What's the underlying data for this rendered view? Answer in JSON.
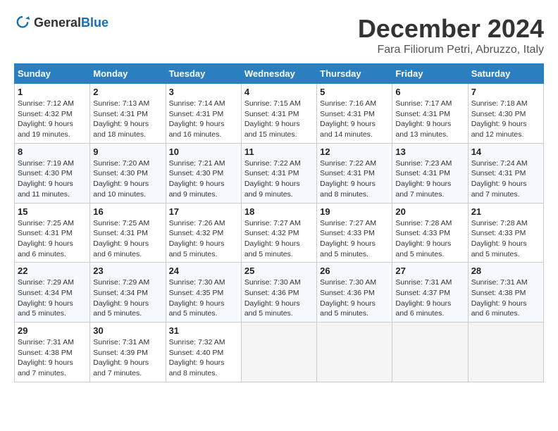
{
  "logo": {
    "general": "General",
    "blue": "Blue"
  },
  "title": "December 2024",
  "location": "Fara Filiorum Petri, Abruzzo, Italy",
  "weekdays": [
    "Sunday",
    "Monday",
    "Tuesday",
    "Wednesday",
    "Thursday",
    "Friday",
    "Saturday"
  ],
  "weeks": [
    [
      {
        "day": "1",
        "sunrise": "7:12 AM",
        "sunset": "4:32 PM",
        "daylight": "9 hours and 19 minutes."
      },
      {
        "day": "2",
        "sunrise": "7:13 AM",
        "sunset": "4:31 PM",
        "daylight": "9 hours and 18 minutes."
      },
      {
        "day": "3",
        "sunrise": "7:14 AM",
        "sunset": "4:31 PM",
        "daylight": "9 hours and 16 minutes."
      },
      {
        "day": "4",
        "sunrise": "7:15 AM",
        "sunset": "4:31 PM",
        "daylight": "9 hours and 15 minutes."
      },
      {
        "day": "5",
        "sunrise": "7:16 AM",
        "sunset": "4:31 PM",
        "daylight": "9 hours and 14 minutes."
      },
      {
        "day": "6",
        "sunrise": "7:17 AM",
        "sunset": "4:31 PM",
        "daylight": "9 hours and 13 minutes."
      },
      {
        "day": "7",
        "sunrise": "7:18 AM",
        "sunset": "4:30 PM",
        "daylight": "9 hours and 12 minutes."
      }
    ],
    [
      {
        "day": "8",
        "sunrise": "7:19 AM",
        "sunset": "4:30 PM",
        "daylight": "9 hours and 11 minutes."
      },
      {
        "day": "9",
        "sunrise": "7:20 AM",
        "sunset": "4:30 PM",
        "daylight": "9 hours and 10 minutes."
      },
      {
        "day": "10",
        "sunrise": "7:21 AM",
        "sunset": "4:30 PM",
        "daylight": "9 hours and 9 minutes."
      },
      {
        "day": "11",
        "sunrise": "7:22 AM",
        "sunset": "4:31 PM",
        "daylight": "9 hours and 9 minutes."
      },
      {
        "day": "12",
        "sunrise": "7:22 AM",
        "sunset": "4:31 PM",
        "daylight": "9 hours and 8 minutes."
      },
      {
        "day": "13",
        "sunrise": "7:23 AM",
        "sunset": "4:31 PM",
        "daylight": "9 hours and 7 minutes."
      },
      {
        "day": "14",
        "sunrise": "7:24 AM",
        "sunset": "4:31 PM",
        "daylight": "9 hours and 7 minutes."
      }
    ],
    [
      {
        "day": "15",
        "sunrise": "7:25 AM",
        "sunset": "4:31 PM",
        "daylight": "9 hours and 6 minutes."
      },
      {
        "day": "16",
        "sunrise": "7:25 AM",
        "sunset": "4:31 PM",
        "daylight": "9 hours and 6 minutes."
      },
      {
        "day": "17",
        "sunrise": "7:26 AM",
        "sunset": "4:32 PM",
        "daylight": "9 hours and 5 minutes."
      },
      {
        "day": "18",
        "sunrise": "7:27 AM",
        "sunset": "4:32 PM",
        "daylight": "9 hours and 5 minutes."
      },
      {
        "day": "19",
        "sunrise": "7:27 AM",
        "sunset": "4:33 PM",
        "daylight": "9 hours and 5 minutes."
      },
      {
        "day": "20",
        "sunrise": "7:28 AM",
        "sunset": "4:33 PM",
        "daylight": "9 hours and 5 minutes."
      },
      {
        "day": "21",
        "sunrise": "7:28 AM",
        "sunset": "4:33 PM",
        "daylight": "9 hours and 5 minutes."
      }
    ],
    [
      {
        "day": "22",
        "sunrise": "7:29 AM",
        "sunset": "4:34 PM",
        "daylight": "9 hours and 5 minutes."
      },
      {
        "day": "23",
        "sunrise": "7:29 AM",
        "sunset": "4:34 PM",
        "daylight": "9 hours and 5 minutes."
      },
      {
        "day": "24",
        "sunrise": "7:30 AM",
        "sunset": "4:35 PM",
        "daylight": "9 hours and 5 minutes."
      },
      {
        "day": "25",
        "sunrise": "7:30 AM",
        "sunset": "4:36 PM",
        "daylight": "9 hours and 5 minutes."
      },
      {
        "day": "26",
        "sunrise": "7:30 AM",
        "sunset": "4:36 PM",
        "daylight": "9 hours and 5 minutes."
      },
      {
        "day": "27",
        "sunrise": "7:31 AM",
        "sunset": "4:37 PM",
        "daylight": "9 hours and 6 minutes."
      },
      {
        "day": "28",
        "sunrise": "7:31 AM",
        "sunset": "4:38 PM",
        "daylight": "9 hours and 6 minutes."
      }
    ],
    [
      {
        "day": "29",
        "sunrise": "7:31 AM",
        "sunset": "4:38 PM",
        "daylight": "9 hours and 7 minutes."
      },
      {
        "day": "30",
        "sunrise": "7:31 AM",
        "sunset": "4:39 PM",
        "daylight": "9 hours and 7 minutes."
      },
      {
        "day": "31",
        "sunrise": "7:32 AM",
        "sunset": "4:40 PM",
        "daylight": "9 hours and 8 minutes."
      },
      null,
      null,
      null,
      null
    ]
  ],
  "labels": {
    "sunrise": "Sunrise:",
    "sunset": "Sunset:",
    "daylight": "Daylight:"
  }
}
